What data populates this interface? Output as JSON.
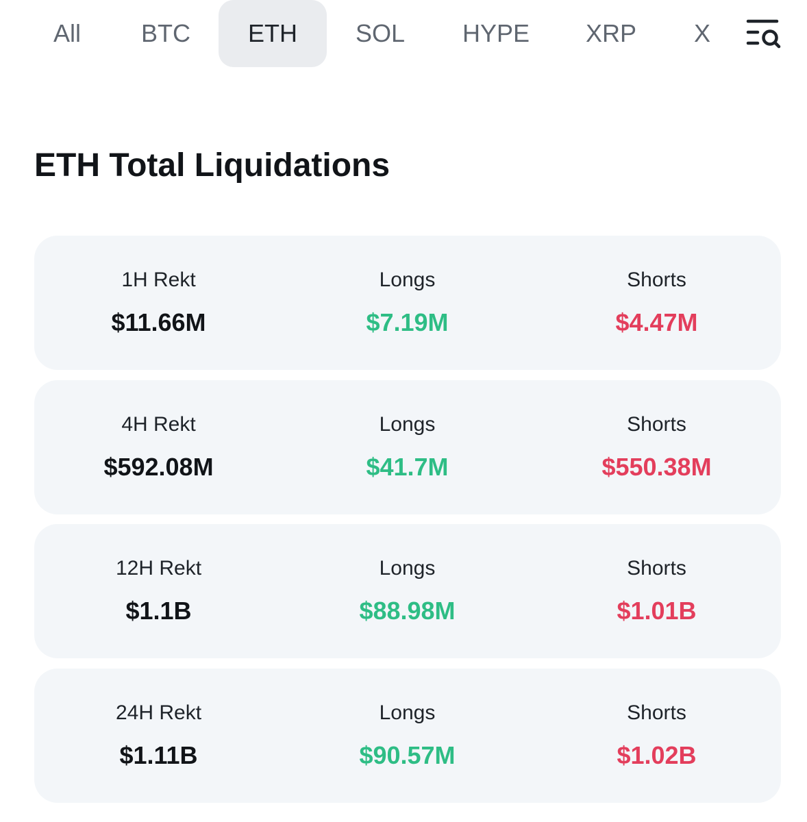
{
  "tabs": [
    {
      "label": "All",
      "active": false
    },
    {
      "label": "BTC",
      "active": false
    },
    {
      "label": "ETH",
      "active": true
    },
    {
      "label": "SOL",
      "active": false
    },
    {
      "label": "HYPE",
      "active": false
    },
    {
      "label": "XRP",
      "active": false
    },
    {
      "label": "X",
      "active": false
    }
  ],
  "filter_icon": "list-search-icon",
  "title": "ETH Total Liquidations",
  "colors": {
    "long": "#2ebd85",
    "short": "#e33e5c",
    "card_bg": "#f3f6f9",
    "active_tab_bg": "#eaecef"
  },
  "rows": [
    {
      "period_label": "1H Rekt",
      "total": "$11.66M",
      "longs_label": "Longs",
      "longs": "$7.19M",
      "shorts_label": "Shorts",
      "shorts": "$4.47M"
    },
    {
      "period_label": "4H Rekt",
      "total": "$592.08M",
      "longs_label": "Longs",
      "longs": "$41.7M",
      "shorts_label": "Shorts",
      "shorts": "$550.38M"
    },
    {
      "period_label": "12H Rekt",
      "total": "$1.1B",
      "longs_label": "Longs",
      "longs": "$88.98M",
      "shorts_label": "Shorts",
      "shorts": "$1.01B"
    },
    {
      "period_label": "24H Rekt",
      "total": "$1.11B",
      "longs_label": "Longs",
      "longs": "$90.57M",
      "shorts_label": "Shorts",
      "shorts": "$1.02B"
    }
  ]
}
